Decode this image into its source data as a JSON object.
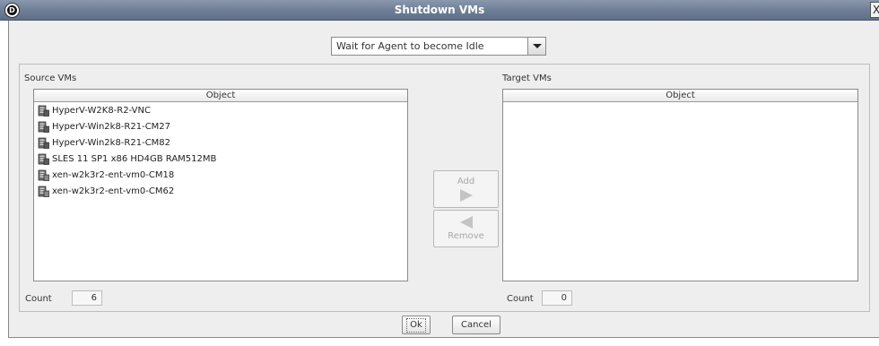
{
  "window": {
    "title": "Shutdown VMs",
    "app_icon_letter": "D",
    "close_glyph": "X"
  },
  "mode_select": {
    "value": "Wait for Agent to become Idle"
  },
  "source": {
    "label": "Source VMs",
    "column_header": "Object",
    "items": [
      {
        "name": "HyperV-W2K8-R2-VNC",
        "icon": "vm-icon"
      },
      {
        "name": "HyperV-Win2k8-R21-CM27",
        "icon": "vm-icon"
      },
      {
        "name": "HyperV-Win2k8-R21-CM82",
        "icon": "vm-icon"
      },
      {
        "name": "SLES 11 SP1 x86 HD4GB RAM512MB",
        "icon": "vm-icon"
      },
      {
        "name": "xen-w2k3r2-ent-vm0-CM18",
        "icon": "vm-template-icon"
      },
      {
        "name": "xen-w2k3r2-ent-vm0-CM62",
        "icon": "vm-template-icon"
      }
    ],
    "count_label": "Count",
    "count": "6"
  },
  "target": {
    "label": "Target VMs",
    "column_header": "Object",
    "items": [],
    "count_label": "Count",
    "count": "0"
  },
  "buttons": {
    "add": "Add",
    "remove": "Remove",
    "ok": "Ok",
    "cancel": "Cancel"
  },
  "colors": {
    "titlebar": "#6f7f98",
    "dialog_bg": "#eeeeee",
    "disabled_text": "#a8a8a8"
  }
}
